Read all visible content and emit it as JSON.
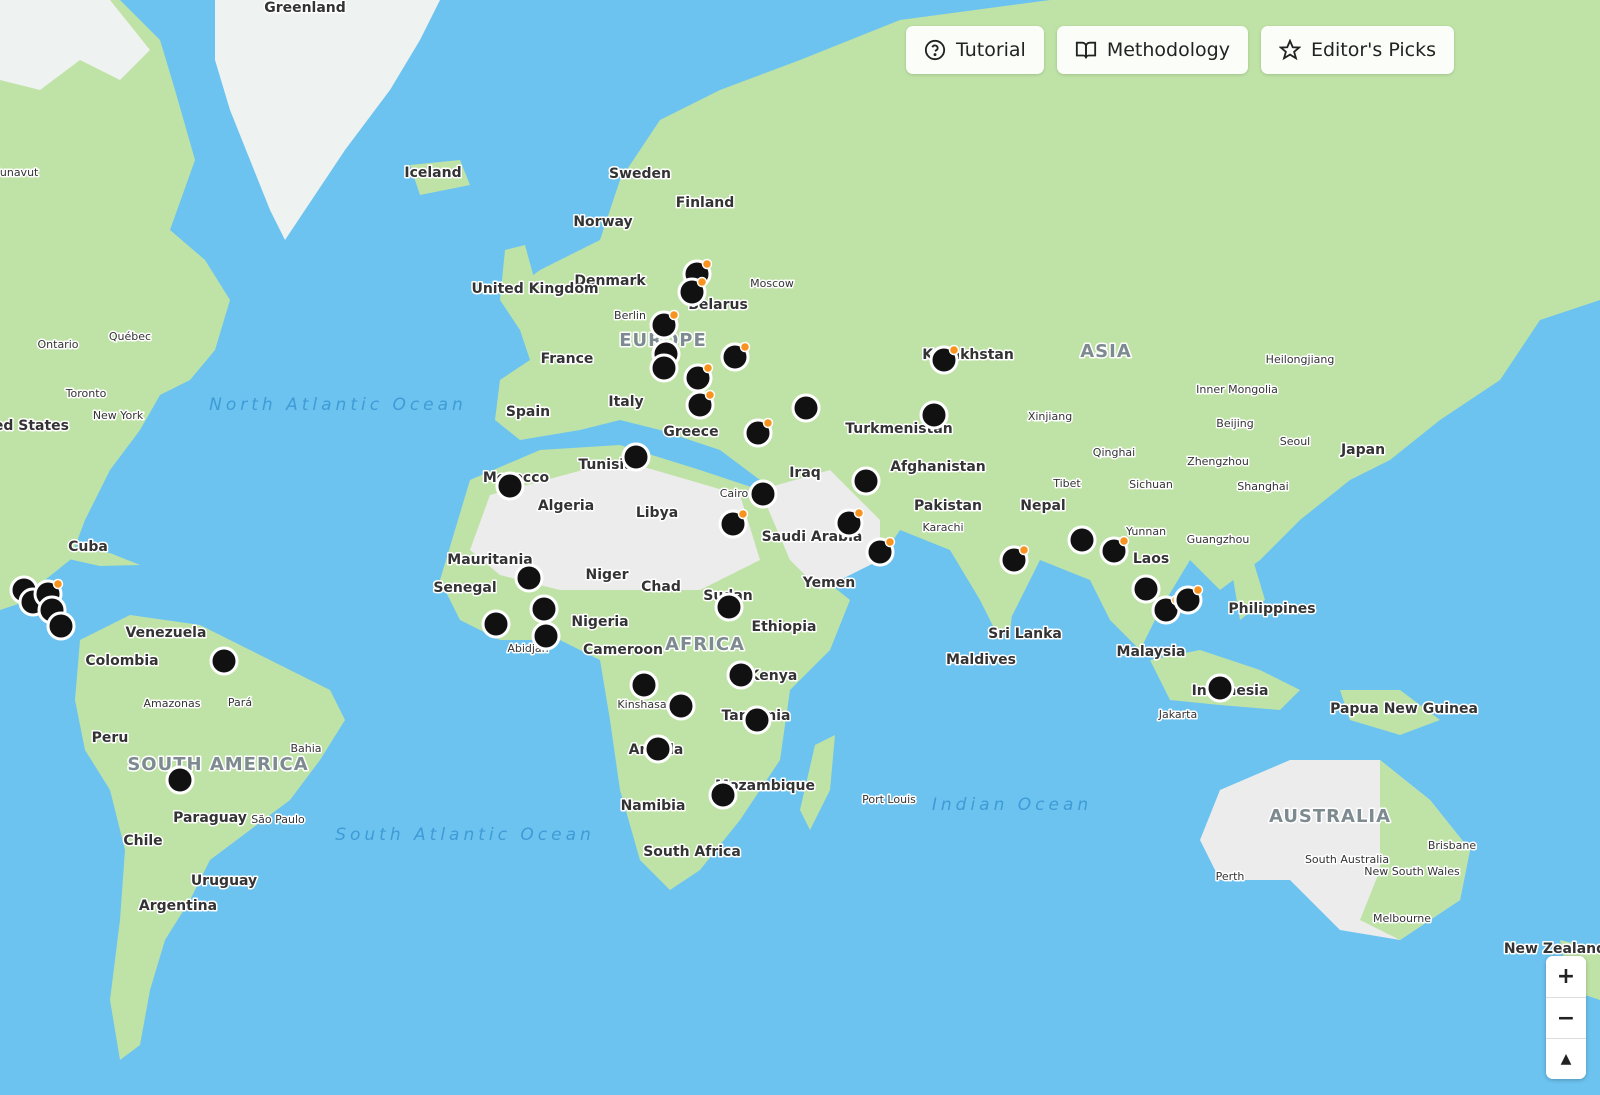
{
  "toolbar": {
    "tutorial_label": "Tutorial",
    "methodology_label": "Methodology",
    "editors_picks_label": "Editor's Picks"
  },
  "zoom": {
    "in_label": "+",
    "out_label": "−",
    "compass_label": "▲"
  },
  "colors": {
    "ocean": "#6cc3f0",
    "land": "#bfe3a6",
    "desert": "#ececec",
    "marker": "#111111",
    "alert": "#f7931e"
  },
  "labels": {
    "greenland": "Greenland",
    "iceland": "Iceland",
    "sweden": "Sweden",
    "finland": "Finland",
    "norway": "Norway",
    "denmark": "Denmark",
    "uk": "United Kingdom",
    "moscow": "Moscow",
    "belarus": "Belarus",
    "berlin": "Berlin",
    "europe": "EUROPE",
    "france": "France",
    "spain": "Spain",
    "italy": "Italy",
    "greece": "Greece",
    "tunisia": "Tunisia",
    "morocco": "Morocco",
    "algeria": "Algeria",
    "libya": "Libya",
    "cairo": "Cairo",
    "saudi": "Saudi Arabia",
    "iraq": "Iraq",
    "yemen": "Yemen",
    "turkmenistan": "Turkmenistan",
    "afghanistan": "Afghanistan",
    "pakistan": "Pakistan",
    "karachi": "Karachi",
    "kazakhstan": "Kazakhstan",
    "asia": "ASIA",
    "xinjiang": "Xinjiang",
    "qinghai": "Qinghai",
    "tibet": "Tibet",
    "nepal": "Nepal",
    "sichuan": "Sichuan",
    "yunnan": "Yunnan",
    "laos": "Laos",
    "heilongjiang": "Heilongjiang",
    "inner_mongolia": "Inner Mongolia",
    "beijing": "Beijing",
    "seoul": "Seoul",
    "japan": "Japan",
    "zhengzhou": "Zhengzhou",
    "shanghai": "Shanghai",
    "guangzhou": "Guangzhou",
    "philippines": "Philippines",
    "malaysia": "Malaysia",
    "indonesia": "Indonesia",
    "jakarta": "Jakarta",
    "png": "Papua New Guinea",
    "australia": "AUSTRALIA",
    "south_australia": "South Australia",
    "nsw": "New South Wales",
    "brisbane": "Brisbane",
    "perth": "Perth",
    "melbourne": "Melbourne",
    "nz": "New Zealand",
    "sri_lanka": "Sri Lanka",
    "maldives": "Maldives",
    "port_louis": "Port Louis",
    "indian_ocean": "Indian Ocean",
    "mauritania": "Mauritania",
    "senegal": "Senegal",
    "niger": "Niger",
    "chad": "Chad",
    "sudan": "Sudan",
    "nigeria": "Nigeria",
    "abidjan": "Abidjan",
    "cameroon": "Cameroon",
    "africa": "AFRICA",
    "ethiopia": "Ethiopia",
    "kenya": "Kenya",
    "kinshasa": "Kinshasa",
    "tanzania": "Tanzania",
    "angola": "Angola",
    "mozambique": "Mozambique",
    "namibia": "Namibia",
    "south_africa": "South Africa",
    "south_atlantic": "South Atlantic Ocean",
    "north_atlantic": "North Atlantic Ocean",
    "nunavut": "Nunavut",
    "ontario": "Ontario",
    "quebec": "Québec",
    "toronto": "Toronto",
    "new_york": "New York",
    "states": "United States",
    "cuba": "Cuba",
    "venezuela": "Venezuela",
    "colombia": "Colombia",
    "amazonas": "Amazonas",
    "para": "Pará",
    "peru": "Peru",
    "bahia": "Bahia",
    "south_america": "SOUTH AMERICA",
    "paraguay": "Paraguay",
    "sao_paulo": "São Paulo",
    "chile": "Chile",
    "uruguay": "Uruguay",
    "argentina": "Argentina"
  },
  "markers_count_note": ""
}
